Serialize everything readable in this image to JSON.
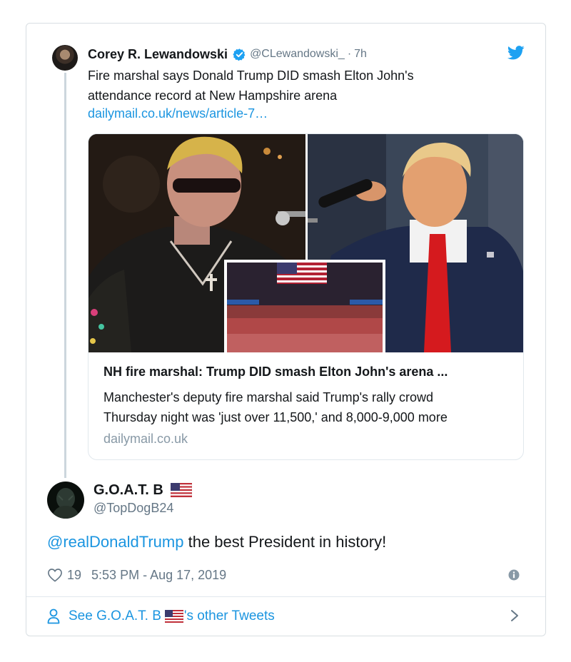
{
  "quoted_tweet": {
    "name": "Corey R. Lewandowski",
    "handle": "@CLewandowski_",
    "separator": "·",
    "time": "7h",
    "text_line_1": "Fire marshal says Donald Trump DID smash Elton John's",
    "text_line_2": "attendance record at New Hampshire arena",
    "link_text": "dailymail.co.uk/news/article-7…",
    "card": {
      "title": "NH fire marshal: Trump DID smash Elton John's arena ...",
      "description_line_1": "Manchester's deputy fire marshal said Trump's rally crowd",
      "description_line_2": "Thursday night was 'just over 11,500,' and 8,000-9,000 more",
      "domain": "dailymail.co.uk"
    },
    "icons": {
      "verified": "verified-badge-icon",
      "brand": "twitter-bird-icon"
    }
  },
  "reply": {
    "name": "G.O.A.T. B",
    "handle": "@TopDogB24",
    "mention": "@realDonaldTrump",
    "text": " the best President in history!",
    "likes": "19",
    "timestamp": "5:53 PM - Aug 17, 2019"
  },
  "footer": {
    "prefix": "See G.O.A.T. B",
    "suffix": "'s other Tweets"
  },
  "colors": {
    "link_blue": "#1b95e0",
    "muted_gray": "#657786",
    "border": "#e1e8ed",
    "text": "#14171a"
  }
}
